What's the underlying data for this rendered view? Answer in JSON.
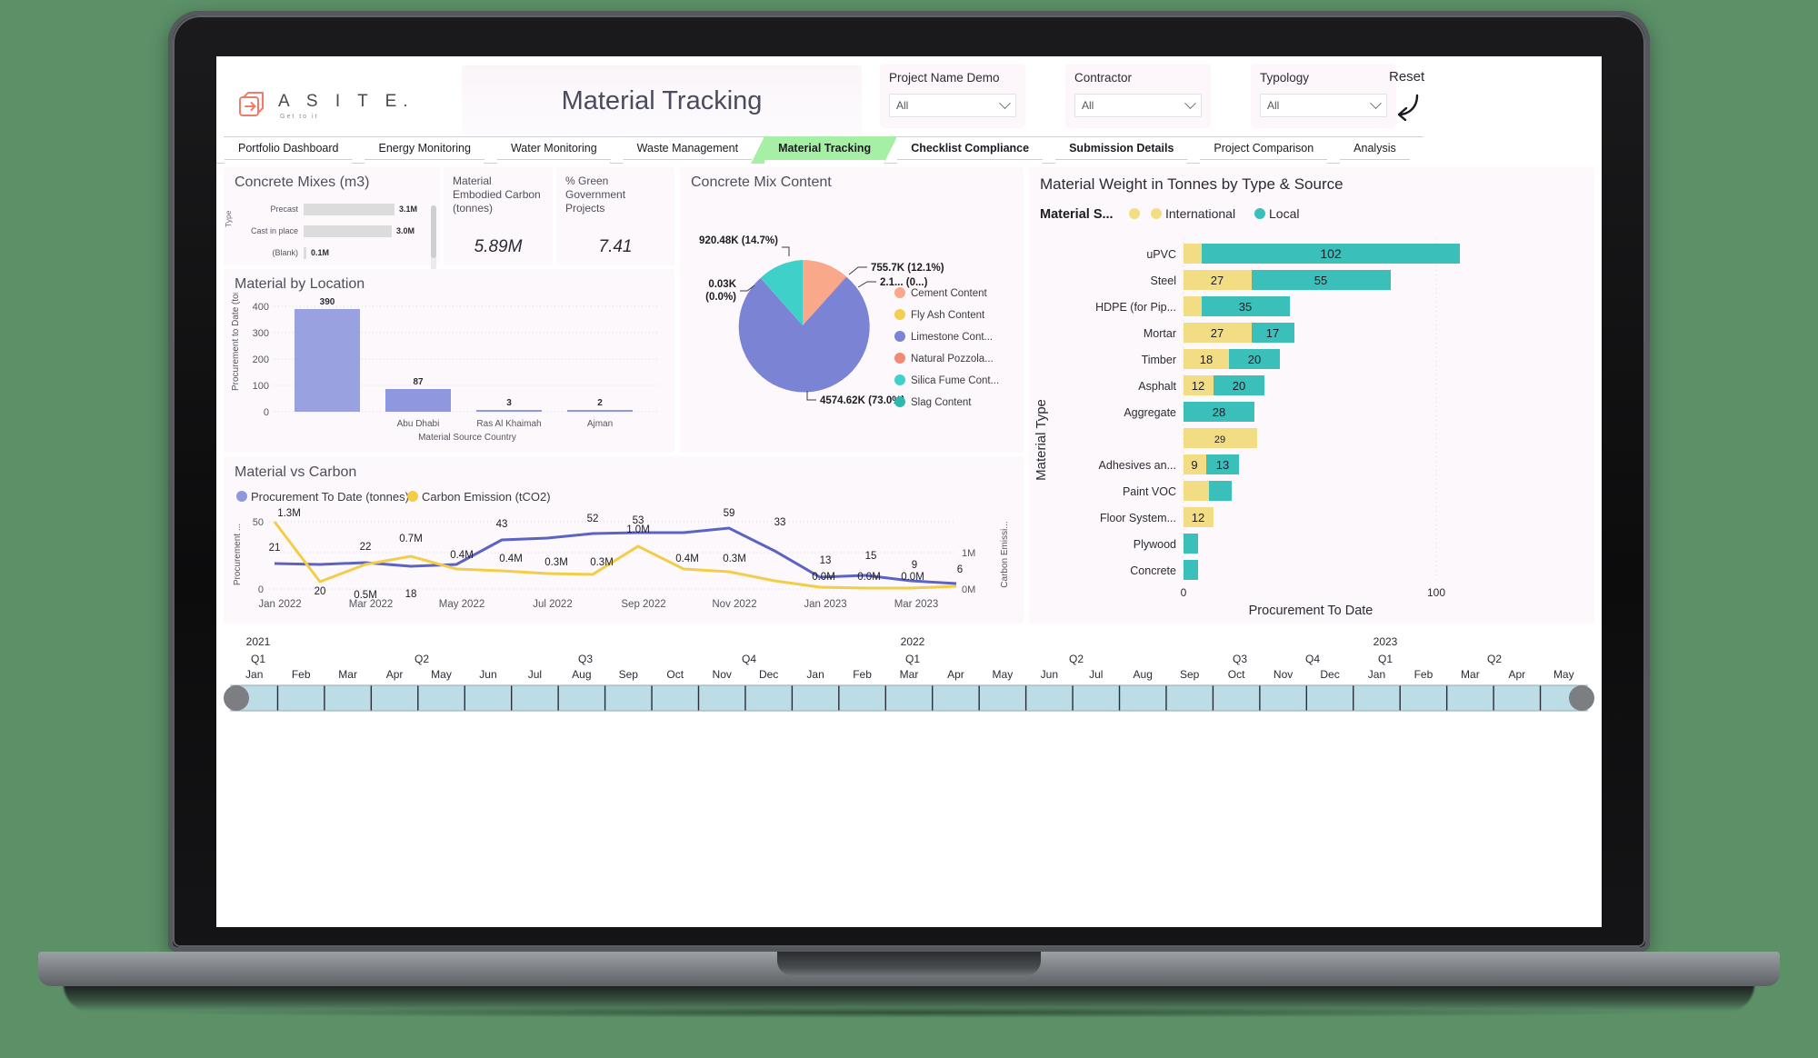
{
  "header": {
    "logo_name": "A S I T E.",
    "logo_tagline": "Get to it",
    "title": "Material Tracking",
    "reset_label": "Reset"
  },
  "filters": [
    {
      "label": "Project Name Demo",
      "value": "All"
    },
    {
      "label": "Contractor",
      "value": "All"
    },
    {
      "label": "Typology",
      "value": "All"
    }
  ],
  "tabs": [
    {
      "label": "Portfolio Dashboard",
      "active": false
    },
    {
      "label": "Energy Monitoring",
      "active": false
    },
    {
      "label": "Water Monitoring",
      "active": false
    },
    {
      "label": "Waste Management",
      "active": false
    },
    {
      "label": "Material Tracking",
      "active": true
    },
    {
      "label": "Checklist Compliance",
      "active": false
    },
    {
      "label": "Submission Details",
      "active": false
    },
    {
      "label": "Project Comparison",
      "active": false
    },
    {
      "label": "Analysis",
      "active": false
    }
  ],
  "panels": {
    "concrete_mixes_title": "Concrete Mixes (m3)",
    "material_location_title": "Material by Location",
    "concrete_content_title": "Concrete Mix Content",
    "material_weight_title": "Material Weight in Tonnes by Type & Source",
    "material_carbon_title": "Material vs Carbon"
  },
  "kpis": [
    {
      "label": "Material Embodied Carbon (tonnes)",
      "value": "5.89M"
    },
    {
      "label": "% Green Government Projects",
      "value": "7.41"
    }
  ],
  "chart_data": [
    {
      "type": "bar",
      "title": "Concrete Mixes (m3)",
      "orientation": "horizontal",
      "ylabel": "Type",
      "categories": [
        "Precast",
        "Cast in place",
        "(Blank)"
      ],
      "values": [
        3.1,
        3.0,
        0.1
      ],
      "value_labels": [
        "3.1M",
        "3.0M",
        "0.1M"
      ],
      "bar_color": "#dcdcdc"
    },
    {
      "type": "bar",
      "title": "Material by Location",
      "xlabel": "Material Source Country",
      "ylabel": "Procurement to Date (tonnes)",
      "categories": [
        "",
        "Abu Dhabi",
        "Ras Al Khaimah",
        "Ajman"
      ],
      "values": [
        390,
        87,
        3,
        2
      ],
      "ylim": [
        0,
        400
      ],
      "yticks": [
        0,
        100,
        200,
        300,
        400
      ],
      "bar_color": "#9aa1e0"
    },
    {
      "type": "pie",
      "title": "Concrete Mix Content",
      "legend_position": "right",
      "labels": [
        "Cement Content",
        "Fly Ash Content",
        "Limestone Cont...",
        "Natural Pozzola...",
        "Silica Fume Cont...",
        "Slag Content"
      ],
      "colors": [
        "#f9a98a",
        "#f2cf52",
        "#7b83d4",
        "#f08a72",
        "#3fd0c9",
        "#2fb8ae"
      ],
      "slices": [
        {
          "name": "Cement Content",
          "value": 755.7,
          "percent": 12.1,
          "label": "755.7K (12.1%)"
        },
        {
          "name": "Limestone Cont...",
          "value": 4574.62,
          "percent": 73.0,
          "label": "4574.62K (73.0%)"
        },
        {
          "name": "Silica Fume Cont...",
          "value": 920.48,
          "percent": 14.7,
          "label": "920.48K (14.7%)"
        },
        {
          "name": "Slag Content",
          "value": 0.03,
          "percent": 0.0,
          "label": "0.03K (0.0%)"
        },
        {
          "name": "Natural Pozzola...",
          "value": 2.1,
          "percent": 0.0,
          "label": "2.1... (0...)"
        }
      ]
    },
    {
      "type": "bar",
      "title": "Material Weight in Tonnes by Type & Source",
      "orientation": "horizontal",
      "stacked": true,
      "legend_title": "Material S...",
      "legend_position": "top",
      "xlabel": "Procurement To Date",
      "ylabel": "Material Type",
      "xticks": [
        0,
        100
      ],
      "xlim": [
        0,
        130
      ],
      "series": [
        {
          "name": "International",
          "color": "#f2dd84"
        },
        {
          "name": "Local",
          "color": "#3bbfbb"
        }
      ],
      "categories": [
        "uPVC",
        "Steel",
        "HDPE (for Pip...",
        "Mortar",
        "Timber",
        "Asphalt",
        "Aggregate",
        "",
        "Adhesives an...",
        "Paint VOC",
        "Floor System...",
        "Plywood",
        "Concrete"
      ],
      "rows": [
        {
          "category": "uPVC",
          "international": 7,
          "local": 102,
          "intl_label": "",
          "local_label": "102"
        },
        {
          "category": "Steel",
          "international": 27,
          "local": 55,
          "intl_label": "27",
          "local_label": "55"
        },
        {
          "category": "HDPE (for Pip...",
          "international": 7,
          "local": 35,
          "intl_label": "",
          "local_label": "35"
        },
        {
          "category": "Mortar",
          "international": 27,
          "local": 17,
          "intl_label": "27",
          "local_label": "17"
        },
        {
          "category": "Timber",
          "international": 18,
          "local": 20,
          "intl_label": "18",
          "local_label": "20"
        },
        {
          "category": "Asphalt",
          "international": 12,
          "local": 20,
          "intl_label": "12",
          "local_label": "20"
        },
        {
          "category": "Aggregate",
          "international": 0,
          "local": 28,
          "intl_label": "",
          "local_label": "28"
        },
        {
          "category": "",
          "international": 29,
          "local": 0,
          "intl_label": "29",
          "local_label": ""
        },
        {
          "category": "Adhesives an...",
          "international": 9,
          "local": 13,
          "intl_label": "9",
          "local_label": "13"
        },
        {
          "category": "Paint VOC",
          "international": 10,
          "local": 9,
          "intl_label": "",
          "local_label": ""
        },
        {
          "category": "Floor System...",
          "international": 12,
          "local": 0,
          "intl_label": "12",
          "local_label": ""
        },
        {
          "category": "Plywood",
          "international": 0,
          "local": 8,
          "intl_label": "",
          "local_label": ""
        },
        {
          "category": "Concrete",
          "international": 0,
          "local": 8,
          "intl_label": "",
          "local_label": ""
        }
      ]
    },
    {
      "type": "line",
      "title": "Material vs Carbon",
      "legend_position": "top",
      "ylabel": "Procurement ...",
      "y2label": "Carbon Emissi...",
      "ylim": [
        0,
        55
      ],
      "yticks": [
        0,
        50
      ],
      "y2ticks": [
        "0M",
        "1M"
      ],
      "xticks": [
        "Jan 2022",
        "Mar 2022",
        "May 2022",
        "Jul 2022",
        "Sep 2022",
        "Nov 2022",
        "Jan 2023",
        "Mar 2023"
      ],
      "x": [
        "Jan 2022",
        "Feb 2022",
        "Mar 2022",
        "Apr 2022",
        "May 2022",
        "Jun 2022",
        "Jul 2022",
        "Aug 2022",
        "Sep 2022",
        "Oct 2022",
        "Nov 2022",
        "Dec 2022",
        "Jan 2023",
        "Feb 2023",
        "Mar 2023",
        "Apr 2023"
      ],
      "series": [
        {
          "name": "Procurement To Date (tonnes)",
          "color": "#5b63c4",
          "values": [
            21,
            20,
            22,
            18,
            20,
            43,
            45,
            52,
            53,
            53,
            59,
            33,
            13,
            15,
            9,
            6
          ],
          "labels": [
            "21",
            "20",
            "22",
            "18",
            "",
            "43",
            "",
            "52",
            "53",
            "",
            "59",
            "33",
            "13",
            "15",
            "9",
            "6"
          ]
        },
        {
          "name": "Carbon Emission (tCO2)",
          "color": "#f2cd48",
          "values": [
            1.3,
            0.2,
            0.5,
            0.7,
            0.4,
            0.4,
            0.3,
            0.3,
            1.0,
            0.4,
            0.3,
            0.1,
            0.0,
            0.0,
            0.0,
            0.02
          ],
          "labels": [
            "1.3M",
            "",
            "0.5M",
            "0.7M",
            "0.4M",
            "0.4M",
            "0.3M",
            "0.3M",
            "1.0M",
            "0.4M",
            "0.3M",
            "",
            "0.0M",
            "0.0M",
            "0.0M",
            ""
          ]
        }
      ]
    }
  ],
  "timeline": {
    "years": [
      {
        "year": "2021",
        "quarters": [
          {
            "q": "Q1",
            "months": [
              "Jan",
              "Feb",
              "Mar"
            ]
          },
          {
            "q": "Q2",
            "months": [
              "Apr",
              "May",
              "Jun"
            ]
          },
          {
            "q": "Q3",
            "months": [
              "Jul",
              "Aug",
              "Sep"
            ]
          },
          {
            "q": "Q4",
            "months": [
              "Oct",
              "Nov",
              "Dec"
            ]
          }
        ]
      },
      {
        "year": "2022",
        "quarters": [
          {
            "q": "Q1",
            "months": [
              "Jan",
              "Feb",
              "Mar"
            ]
          },
          {
            "q": "Q2",
            "months": [
              "Apr",
              "May",
              "Jun"
            ]
          },
          {
            "q": "Q3",
            "months": [
              "Jul",
              "Aug",
              "Sep"
            ]
          },
          {
            "q": "Q4",
            "months": [
              "Oct",
              "Nov",
              "Dec"
            ]
          }
        ]
      },
      {
        "year": "2023",
        "quarters": [
          {
            "q": "Q1",
            "months": [
              "Jan",
              "Feb",
              "Mar"
            ]
          },
          {
            "q": "Q2",
            "months": [
              "Apr",
              "May"
            ]
          }
        ]
      }
    ]
  }
}
